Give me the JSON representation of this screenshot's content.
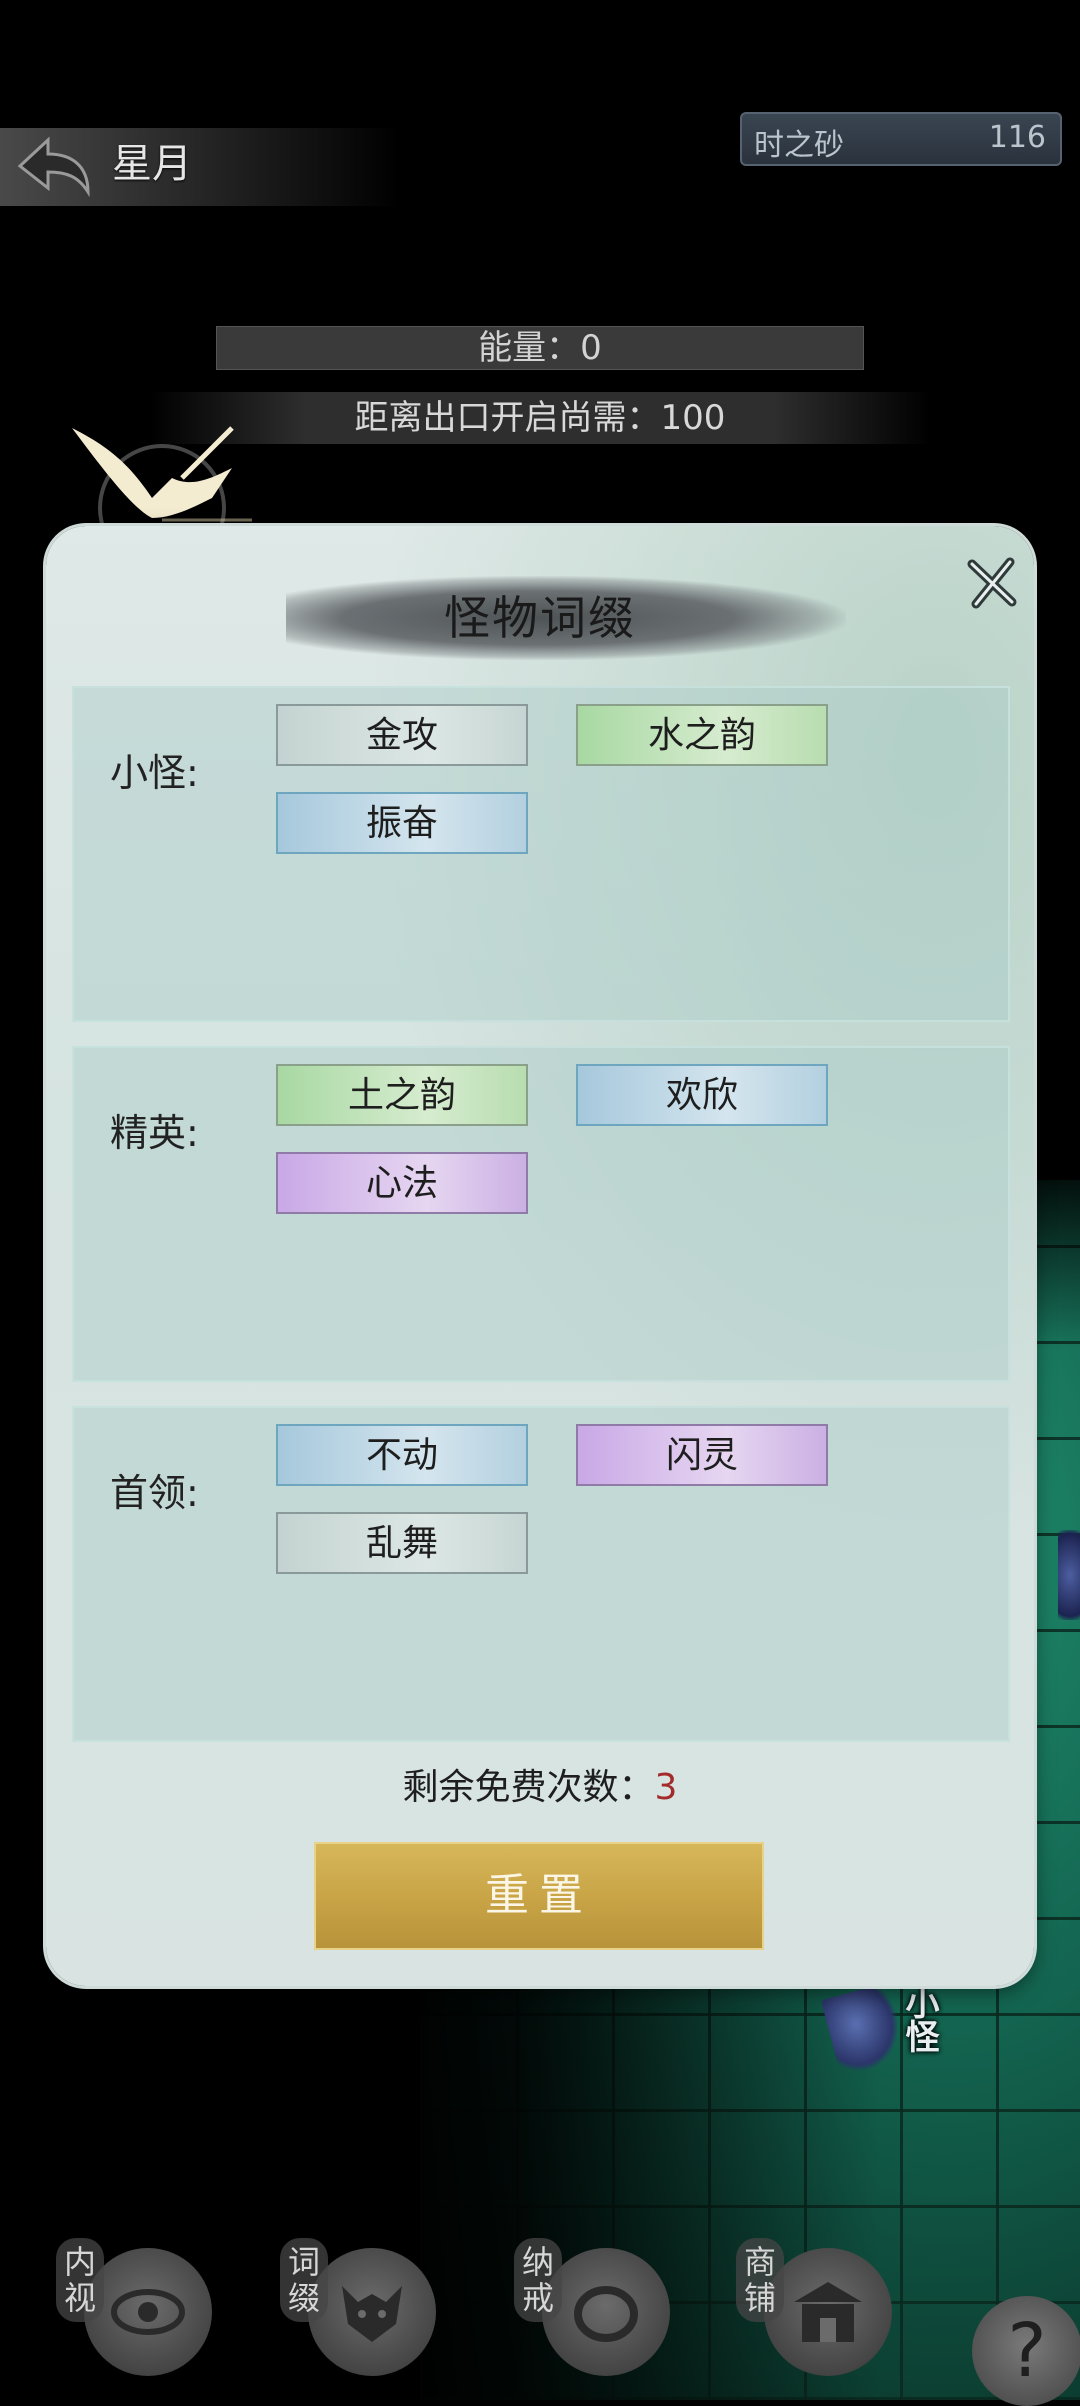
{
  "header": {
    "title": "星月",
    "currency": {
      "name": "时之砂",
      "value": "116"
    }
  },
  "status": {
    "energy": "能量：0",
    "distance": "距离出口开启尚需：100"
  },
  "modal": {
    "title": "怪物词缀",
    "sections": [
      {
        "label": "小怪:",
        "tags": [
          {
            "text": "金攻",
            "color": "gray"
          },
          {
            "text": "水之韵",
            "color": "green"
          },
          {
            "text": "振奋",
            "color": "blue"
          }
        ]
      },
      {
        "label": "精英:",
        "tags": [
          {
            "text": "土之韵",
            "color": "green"
          },
          {
            "text": "欢欣",
            "color": "blue"
          },
          {
            "text": "心法",
            "color": "purple"
          }
        ]
      },
      {
        "label": "首领:",
        "tags": [
          {
            "text": "不动",
            "color": "blue"
          },
          {
            "text": "闪灵",
            "color": "purple"
          },
          {
            "text": "乱舞",
            "color": "gray"
          }
        ]
      }
    ],
    "free_label": "剩余免费次数：",
    "free_count": "3",
    "reset_label": "重置"
  },
  "scene": {
    "monster_tag": "小怪"
  },
  "nav": {
    "items": [
      {
        "label": "内视",
        "icon": "eye-icon"
      },
      {
        "label": "词缀",
        "icon": "demon-mask-icon"
      },
      {
        "label": "纳戒",
        "icon": "ring-icon"
      },
      {
        "label": "商铺",
        "icon": "shop-icon"
      }
    ],
    "help": "?"
  },
  "colors": {
    "tag_gray": "#c4d3d1",
    "tag_blue": "#a6c8dc",
    "tag_green": "#a8d8a2",
    "tag_purple": "#c9a8e6",
    "reset_gold": "#c9a547",
    "free_count_red": "#a32b2b"
  }
}
